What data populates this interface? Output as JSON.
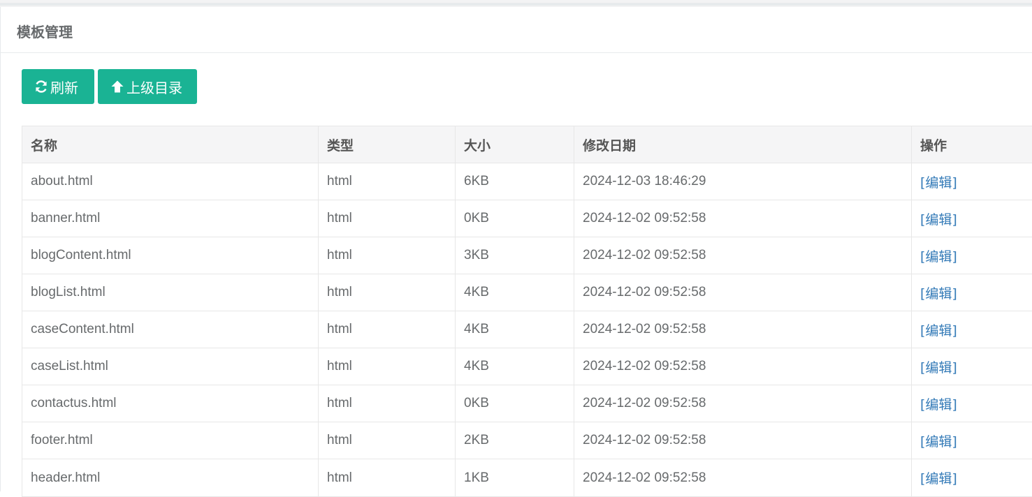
{
  "panel": {
    "title": "模板管理"
  },
  "toolbar": {
    "refresh_label": "刷新",
    "refresh_icon": "refresh-icon",
    "up_label": "上级目录",
    "up_icon": "arrow-up-icon",
    "button_color": "#1ab394"
  },
  "table": {
    "headers": [
      "名称",
      "类型",
      "大小",
      "修改日期",
      "操作"
    ],
    "rows": [
      {
        "name": "about.html",
        "type": "html",
        "size": "6KB",
        "modified": "2024-12-03 18:46:29",
        "action": "[编辑]"
      },
      {
        "name": "banner.html",
        "type": "html",
        "size": "0KB",
        "modified": "2024-12-02 09:52:58",
        "action": "[编辑]"
      },
      {
        "name": "blogContent.html",
        "type": "html",
        "size": "3KB",
        "modified": "2024-12-02 09:52:58",
        "action": "[编辑]"
      },
      {
        "name": "blogList.html",
        "type": "html",
        "size": "4KB",
        "modified": "2024-12-02 09:52:58",
        "action": "[编辑]"
      },
      {
        "name": "caseContent.html",
        "type": "html",
        "size": "4KB",
        "modified": "2024-12-02 09:52:58",
        "action": "[编辑]"
      },
      {
        "name": "caseList.html",
        "type": "html",
        "size": "4KB",
        "modified": "2024-12-02 09:52:58",
        "action": "[编辑]"
      },
      {
        "name": "contactus.html",
        "type": "html",
        "size": "0KB",
        "modified": "2024-12-02 09:52:58",
        "action": "[编辑]"
      },
      {
        "name": "footer.html",
        "type": "html",
        "size": "2KB",
        "modified": "2024-12-02 09:52:58",
        "action": "[编辑]"
      },
      {
        "name": "header.html",
        "type": "html",
        "size": "1KB",
        "modified": "2024-12-02 09:52:58",
        "action": "[编辑]"
      }
    ],
    "link_color": "#337ab7"
  }
}
